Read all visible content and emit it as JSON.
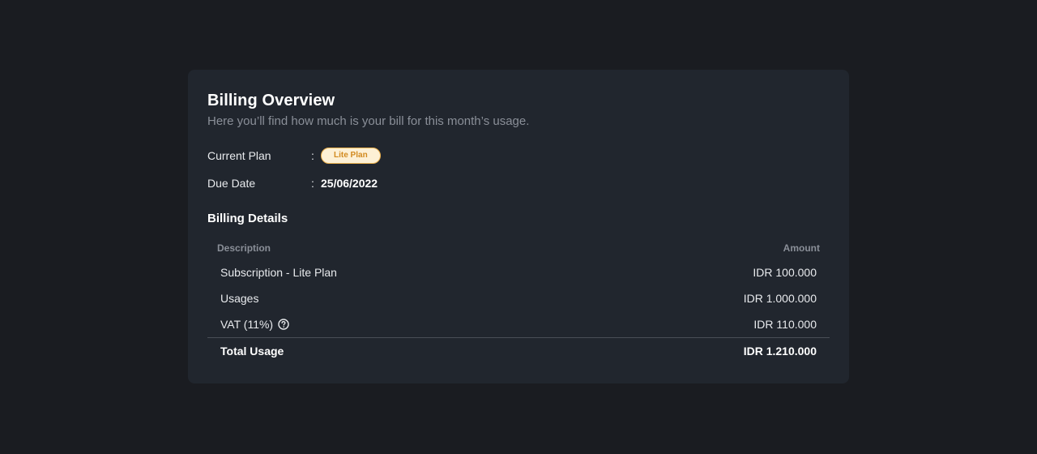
{
  "billing": {
    "title": "Billing Overview",
    "subtitle": "Here you’ll find how much is your bill for this month’s usage.",
    "current_plan_label": "Current Plan",
    "current_plan_value": "Lite Plan",
    "due_date_label": "Due Date",
    "due_date_value": "25/06/2022",
    "colon": ":"
  },
  "details": {
    "title": "Billing Details",
    "columns": {
      "description": "Description",
      "amount": "Amount"
    },
    "rows": [
      {
        "description": "Subscription - Lite Plan",
        "amount": "IDR 100.000"
      },
      {
        "description": "Usages",
        "amount": "IDR 1.000.000"
      },
      {
        "description": "VAT (11%)",
        "amount": "IDR 110.000",
        "icon": "help-circle-icon"
      }
    ],
    "total": {
      "description": "Total Usage",
      "amount": "IDR 1.210.000"
    }
  },
  "colors": {
    "page_background": "#1a1c21",
    "card_background": "#21262e",
    "badge_background": "#fdf0d5",
    "badge_text": "#d28a1f",
    "badge_border": "#f0b450",
    "muted_text": "#8a8f98"
  }
}
